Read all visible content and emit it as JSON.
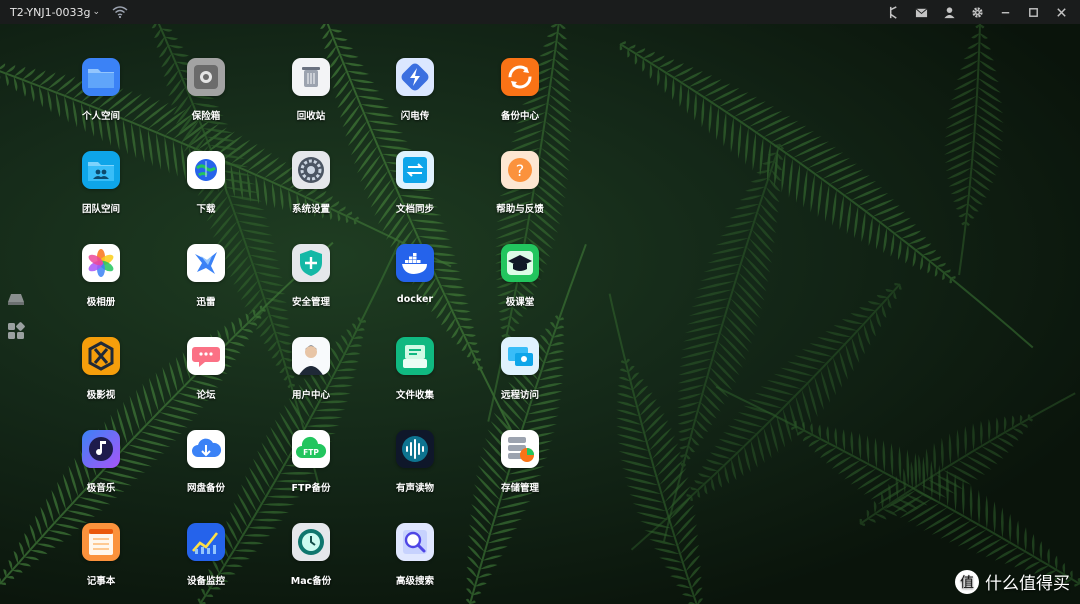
{
  "titlebar": {
    "device_name": "T2-YNJ1-0033g",
    "icons": [
      "pin-icon",
      "mail-icon",
      "user-icon",
      "gear-icon",
      "minimize-icon",
      "maximize-icon",
      "close-icon"
    ]
  },
  "dock": [
    "drive-icon",
    "apps-grid-icon"
  ],
  "apps": [
    {
      "label": "个人空间",
      "icon": "folder-icon",
      "color": "#3b82f6"
    },
    {
      "label": "保险箱",
      "icon": "safe-icon",
      "color": "#9ca3af"
    },
    {
      "label": "回收站",
      "icon": "trash-icon",
      "color": "#f3f4f6"
    },
    {
      "label": "闪电传",
      "icon": "lightning-icon",
      "color": "#3b6fe0"
    },
    {
      "label": "备份中心",
      "icon": "backup-sync-icon",
      "color": "#f97316"
    },
    {
      "label": "团队空间",
      "icon": "team-folder-icon",
      "color": "#38bdf8"
    },
    {
      "label": "下载",
      "icon": "globe-download-icon",
      "color": "#ffffff"
    },
    {
      "label": "系统设置",
      "icon": "settings-gear-icon",
      "color": "#4b5563"
    },
    {
      "label": "文档同步",
      "icon": "document-sync-icon",
      "color": "#0ea5e9"
    },
    {
      "label": "帮助与反馈",
      "icon": "help-icon",
      "color": "#fb923c"
    },
    {
      "label": "极相册",
      "icon": "photos-icon",
      "color": "#ffffff"
    },
    {
      "label": "迅雷",
      "icon": "thunder-bird-icon",
      "color": "#ffffff"
    },
    {
      "label": "安全管理",
      "icon": "shield-plus-icon",
      "color": "#e5e7eb"
    },
    {
      "label": "docker",
      "icon": "docker-whale-icon",
      "color": "#2563eb"
    },
    {
      "label": "极课堂",
      "icon": "graduation-cap-icon",
      "color": "#22c55e"
    },
    {
      "label": "极影视",
      "icon": "film-icon",
      "color": "#f59e0b"
    },
    {
      "label": "论坛",
      "icon": "chat-bubble-icon",
      "color": "#ffffff"
    },
    {
      "label": "用户中心",
      "icon": "user-avatar-icon",
      "color": "#ffffff"
    },
    {
      "label": "文件收集",
      "icon": "file-collect-icon",
      "color": "#10b981"
    },
    {
      "label": "远程访问",
      "icon": "remote-access-icon",
      "color": "#e5e7eb"
    },
    {
      "label": "极音乐",
      "icon": "music-note-icon",
      "color": "#6366f1"
    },
    {
      "label": "网盘备份",
      "icon": "cloud-download-icon",
      "color": "#ffffff"
    },
    {
      "label": "FTP备份",
      "icon": "ftp-cloud-icon",
      "color": "#ffffff"
    },
    {
      "label": "有声读物",
      "icon": "audio-wave-icon",
      "color": "#0f172a"
    },
    {
      "label": "存储管理",
      "icon": "storage-pie-icon",
      "color": "#ffffff"
    },
    {
      "label": "记事本",
      "icon": "notepad-icon",
      "color": "#fb923c"
    },
    {
      "label": "设备监控",
      "icon": "chart-monitor-icon",
      "color": "#2563eb"
    },
    {
      "label": "Mac备份",
      "icon": "time-machine-icon",
      "color": "#0f766e"
    },
    {
      "label": "高级搜索",
      "icon": "search-magnifier-icon",
      "color": "#e0e7ff"
    }
  ],
  "watermark": {
    "text": "什么值得买",
    "logo": "值"
  }
}
